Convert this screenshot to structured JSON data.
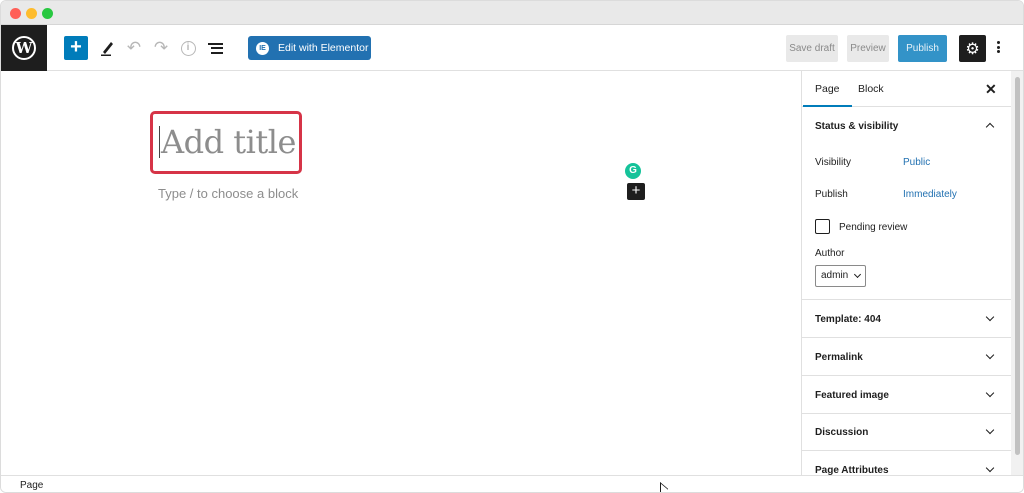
{
  "header": {
    "logo_letter": "W",
    "inserter_symbol": "+",
    "edit_elementor_label": "Edit with Elementor",
    "elementor_icon_text": "IE",
    "save_draft_label": "Save draft",
    "preview_label": "Preview",
    "publish_label": "Publish",
    "settings_symbol": "⚙"
  },
  "canvas": {
    "title_placeholder": "Add title",
    "block_hint": "Type / to choose a block",
    "grammarly_letter": "G",
    "add_block_symbol": "+"
  },
  "sidebar": {
    "tabs": [
      "Page",
      "Block"
    ],
    "close_symbol": "✕",
    "status_visibility": {
      "title": "Status & visibility",
      "visibility_label": "Visibility",
      "visibility_value": "Public",
      "publish_label": "Publish",
      "publish_value": "Immediately",
      "pending_review_label": "Pending review",
      "pending_review_checked": false,
      "author_label": "Author",
      "author_value": "admin"
    },
    "panels": [
      "Template: 404",
      "Permalink",
      "Featured image",
      "Discussion",
      "Page Attributes"
    ]
  },
  "footer": {
    "breadcrumb": "Page"
  },
  "colors": {
    "accent": "#007cba",
    "publish": "#3393c8",
    "highlight_border": "#d63447",
    "link": "#2271b1"
  }
}
